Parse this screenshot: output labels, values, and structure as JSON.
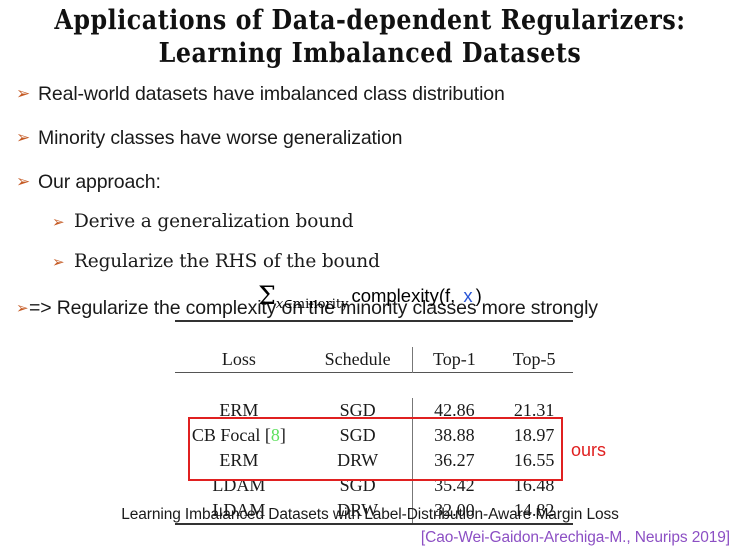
{
  "slide": {
    "title_line_1": "Applications of Data-dependent Regularizers:",
    "title_line_2": "Learning Imbalanced Datasets",
    "bullet_glyph": "➢",
    "accent_bullet_color": "#c55a24",
    "highlight_color": "#e02020",
    "citation_color": "#8c4fc4",
    "blue_var_color": "#2a56d6",
    "cite_link_color": "#5ee05e"
  },
  "bullets": [
    {
      "level": 1,
      "text": "Real-world datasets have imbalanced class distribution"
    },
    {
      "level": 1,
      "text": "Minority classes have worse generalization"
    },
    {
      "level": 1,
      "text": "Our approach:"
    },
    {
      "level": 2,
      "text": "Derive a generalization bound"
    },
    {
      "level": 2,
      "text": "Regularize the RHS of the bound"
    },
    {
      "level": 1,
      "text": "=> Regularize the complexity on the minority classes more strongly"
    }
  ],
  "formula": {
    "sigma": "Σ",
    "subscript_var": "x",
    "subscript_rest": "∈minority",
    "body_prefix": "complexity(f, ",
    "body_var": "x",
    "body_suffix": ")"
  },
  "table": {
    "columns": [
      "Loss",
      "Schedule",
      "Top-1",
      "Top-5"
    ],
    "rows": [
      {
        "loss": "ERM",
        "loss_cite": "",
        "schedule": "SGD",
        "top1": "42.86",
        "top5": "21.31",
        "bold": false,
        "boxed": false
      },
      {
        "loss": "CB Focal [",
        "loss_cite": "8",
        "loss_suffix": "]",
        "schedule": "SGD",
        "top1": "38.88",
        "top5": "18.97",
        "bold": false,
        "boxed": false
      },
      {
        "loss": "ERM",
        "loss_cite": "",
        "schedule": "DRW",
        "top1": "36.27",
        "top5": "16.55",
        "bold": false,
        "boxed": true
      },
      {
        "loss": "LDAM",
        "loss_cite": "",
        "schedule": "SGD",
        "top1": "35.42",
        "top5": "16.48",
        "bold": false,
        "boxed": true
      },
      {
        "loss": "LDAM",
        "loss_cite": "",
        "schedule": "DRW",
        "top1": "32.00",
        "top5": "14.82",
        "bold": true,
        "boxed": true
      }
    ],
    "annotation": "ours"
  },
  "footer": {
    "paper_title": "Learning Imbalanced Datasets with Label-Distribution-Aware Margin Loss",
    "citation": "[Cao-Wei-Gaidon-Arechiga-M., Neurips 2019]"
  }
}
